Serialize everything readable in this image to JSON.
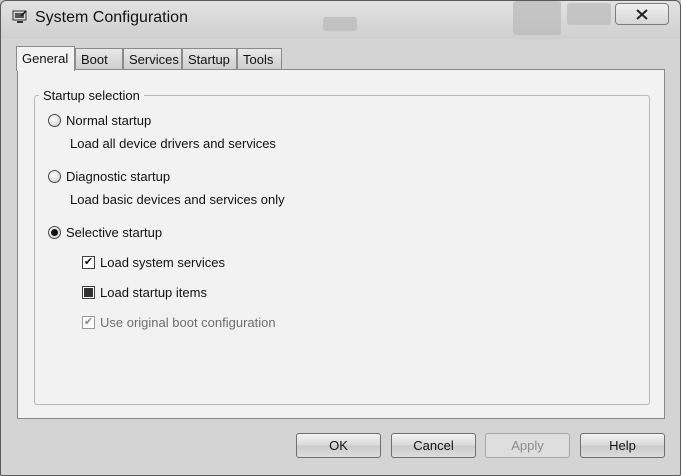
{
  "window": {
    "title": "System Configuration"
  },
  "tabs": [
    {
      "label": "General",
      "active": true
    },
    {
      "label": "Boot",
      "active": false
    },
    {
      "label": "Services",
      "active": false
    },
    {
      "label": "Startup",
      "active": false
    },
    {
      "label": "Tools",
      "active": false
    }
  ],
  "startup_selection": {
    "group_label": "Startup selection",
    "normal": {
      "label": "Normal startup",
      "description": "Load all device drivers and services",
      "selected": false
    },
    "diagnostic": {
      "label": "Diagnostic startup",
      "description": "Load basic devices and services only",
      "selected": false
    },
    "selective": {
      "label": "Selective startup",
      "selected": true
    },
    "options": {
      "load_system_services": {
        "label": "Load system services",
        "state": "checked"
      },
      "load_startup_items": {
        "label": "Load startup items",
        "state": "indeterminate"
      },
      "use_original_boot": {
        "label": "Use original boot configuration",
        "state": "checked-disabled"
      }
    }
  },
  "buttons": {
    "ok": "OK",
    "cancel": "Cancel",
    "apply": "Apply",
    "help": "Help"
  },
  "icons": {
    "app": "msconfig-icon",
    "close": "close-icon",
    "radio": "radio-icon",
    "checkbox": "checkbox-icon"
  }
}
